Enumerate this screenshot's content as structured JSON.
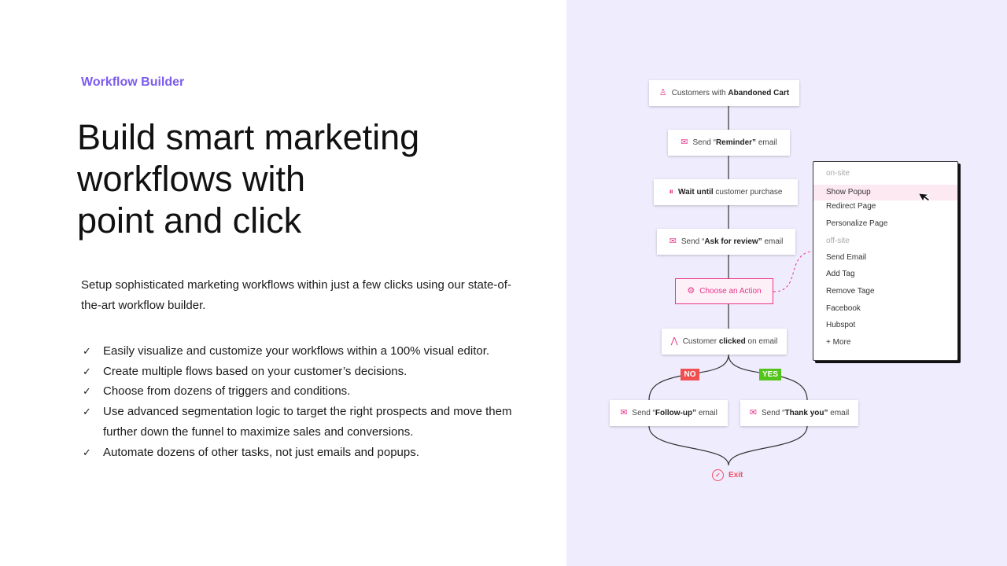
{
  "eyebrow": "Workflow Builder",
  "title_lines": [
    "Build smart marketing",
    "workflows with",
    "point and click"
  ],
  "description": "Setup sophisticated marketing workflows within just a few clicks using our state-of-the-art workflow builder.",
  "features": [
    "Easily visualize and customize your workflows within a 100% visual editor.",
    "Create multiple flows based on your customer’s decisions.",
    "Choose from dozens of triggers and conditions.",
    "Use advanced segmentation logic to target the right prospects and move them further down the funnel to maximize sales and conversions.",
    "Automate dozens of other tasks, not just emails and popups."
  ],
  "check_icon": "✓",
  "workflow": {
    "nodes": [
      {
        "icon": "user-icon",
        "pre": "Customers with ",
        "bold": "Abandoned Cart",
        "post": ""
      },
      {
        "icon": "mail-icon",
        "pre": "Send “",
        "bold": "Reminder”",
        "post": " email"
      },
      {
        "icon": "pause-icon",
        "pre": "",
        "bold": "Wait until",
        "post": " customer purchase"
      },
      {
        "icon": "mail-icon",
        "pre": "Send “",
        "bold": "Ask for review”",
        "post": " email"
      },
      {
        "icon": "gear-icon",
        "pre": "Choose an Action",
        "bold": "",
        "post": ""
      },
      {
        "icon": "split-icon",
        "pre": "Customer ",
        "bold": "clicked",
        "post": " on email"
      },
      {
        "icon": "mail-icon",
        "pre": "Send “",
        "bold": "Follow-up”",
        "post": " email"
      },
      {
        "icon": "mail-icon",
        "pre": "Send “",
        "bold": "Thank you”",
        "post": " email"
      }
    ],
    "no_label": "NO",
    "yes_label": "YES",
    "exit_label": "Exit",
    "colors": {
      "accent": "#e8358a",
      "no": "#f05050",
      "yes": "#52c41a",
      "brand": "#7b5cf0",
      "panel_bg": "#efecfd"
    }
  },
  "menu": {
    "groups": [
      {
        "label": "on-site",
        "items": [
          "Show Popup",
          "Redirect Page",
          "Personalize Page"
        ]
      },
      {
        "label": "off-site",
        "items": [
          "Send Email",
          "Add Tag",
          "Remove Tage",
          "Facebook",
          "Hubspot",
          "+ More"
        ]
      }
    ],
    "highlighted": "Show Popup"
  }
}
